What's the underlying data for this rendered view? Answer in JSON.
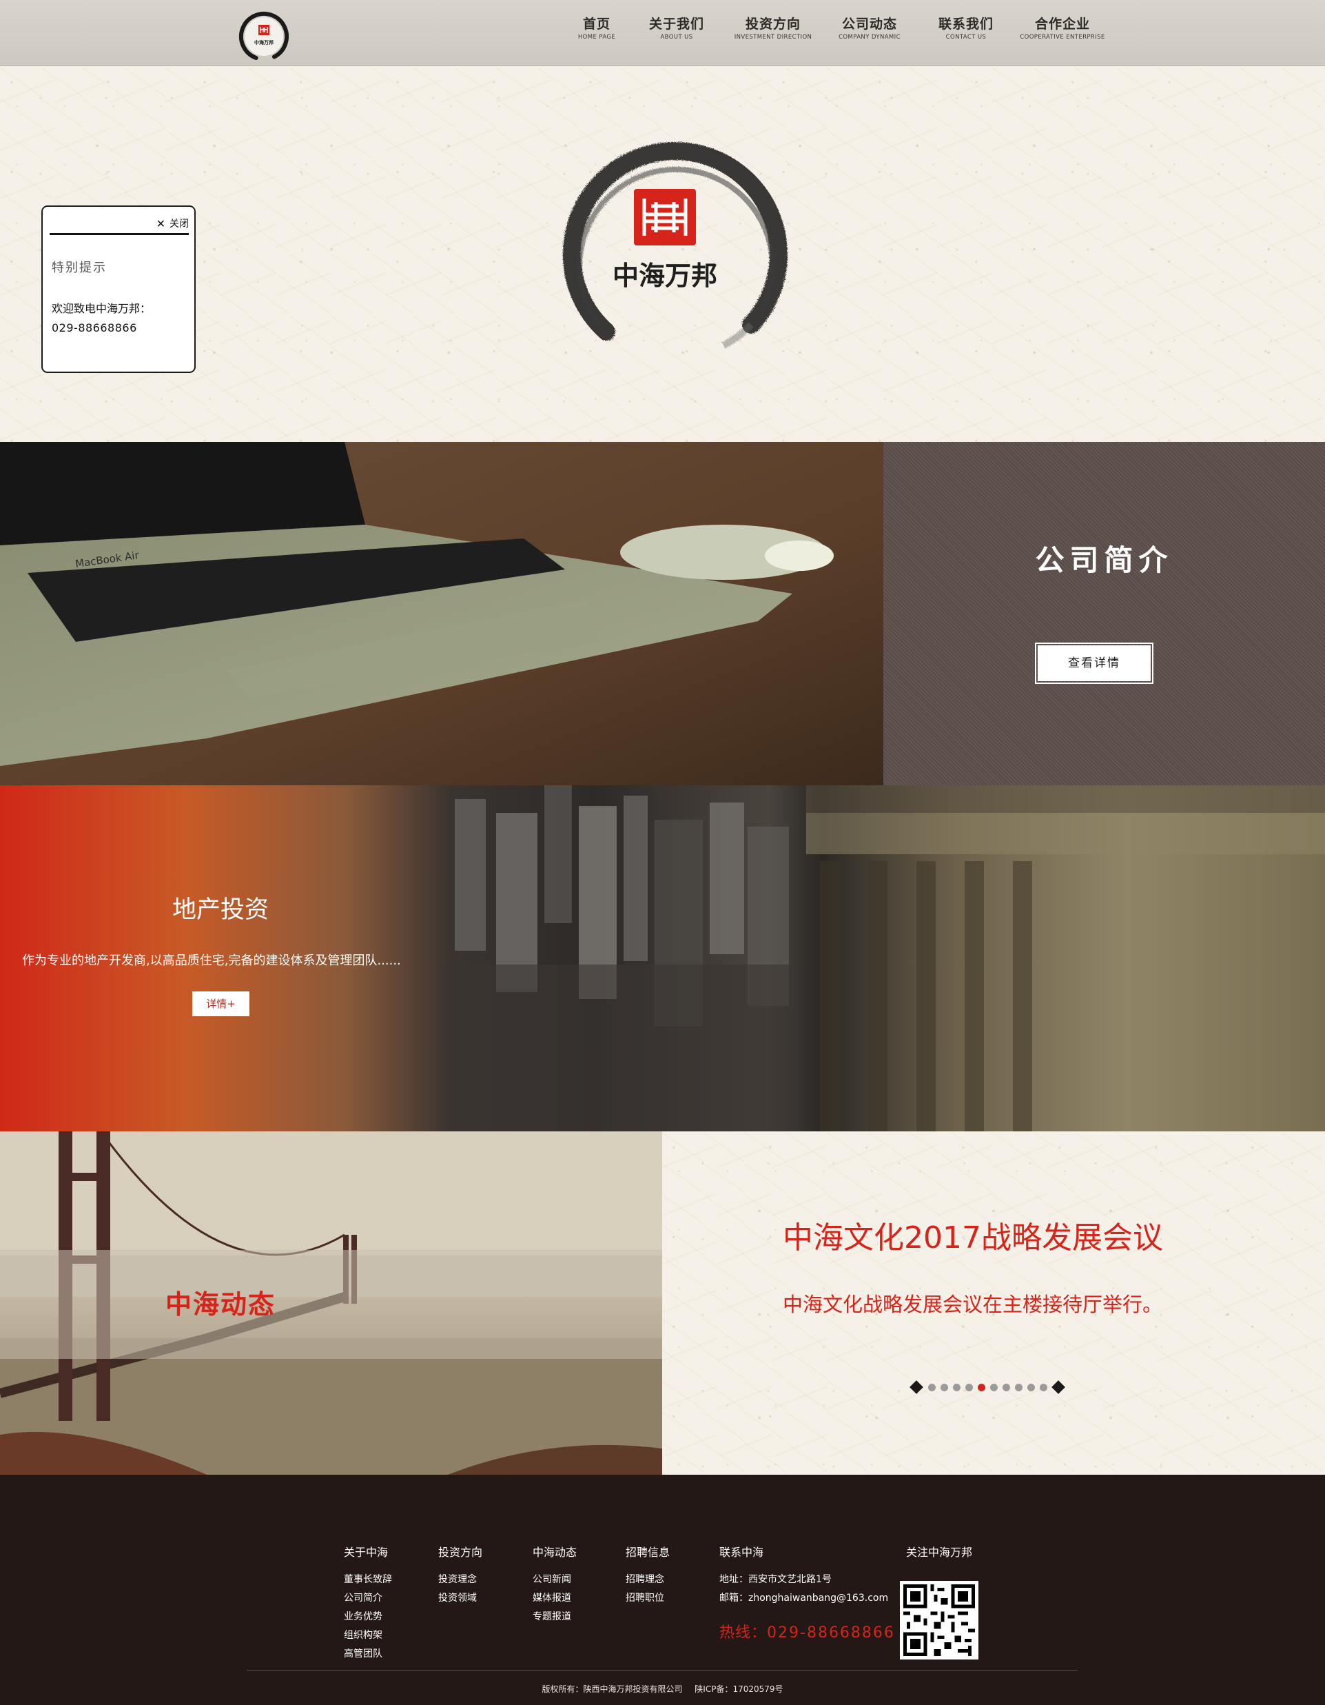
{
  "header": {
    "logo_text": "中海万邦",
    "nav": [
      {
        "zh": "首页",
        "en": "HOME PAGE"
      },
      {
        "zh": "关于我们",
        "en": "ABOUT US"
      },
      {
        "zh": "投资方向",
        "en": "INVESTMENT DIRECTION"
      },
      {
        "zh": "公司动态",
        "en": "COMPANY DYNAMIC"
      },
      {
        "zh": "联系我们",
        "en": "CONTACT US"
      },
      {
        "zh": "合作企业",
        "en": "COOPERATIVE ENTERPRISE"
      }
    ]
  },
  "hero": {
    "brand_name": "中海万邦"
  },
  "popup": {
    "close_label": "关闭",
    "title": "特别提示",
    "line1": "欢迎致电中海万邦：",
    "line2": "029-88668866"
  },
  "about": {
    "photo_caption": "MacBook Air",
    "title": "公司简介",
    "button": "查看详情"
  },
  "realestate": {
    "title": "地产投资",
    "description": "作为专业的地产开发商,以高品质住宅,完备的建设体系及管理团队......",
    "button": "详情+"
  },
  "news": {
    "label": "中海动态",
    "title": "中海文化2017战略发展会议",
    "description": "中海文化战略发展会议在主楼接待厅举行。",
    "dot_count": 10,
    "active_dot": 4
  },
  "footer": {
    "columns": [
      {
        "head": "关于中海",
        "links": [
          "董事长致辞",
          "公司简介",
          "业务优势",
          "组织构架",
          "高管团队"
        ]
      },
      {
        "head": "投资方向",
        "links": [
          "投资理念",
          "投资领域"
        ]
      },
      {
        "head": "中海动态",
        "links": [
          "公司新闻",
          "媒体报道",
          "专题报道"
        ]
      },
      {
        "head": "招聘信息",
        "links": [
          "招聘理念",
          "招聘职位"
        ]
      }
    ],
    "contact": {
      "head": "联系中海",
      "address": "地址：西安市文艺北路1号",
      "email": "邮箱：zhonghaiwanbang@163.com",
      "hotline_label": "热线：",
      "hotline": "029-88668866"
    },
    "follow_head": "关注中海万邦",
    "copyright": "版权所有：陕西中海万邦投资有限公司",
    "icp": "陕ICP备：17020579号"
  },
  "colors": {
    "brand_red": "#d7241a",
    "footer_bg": "#231815",
    "header_bg": "#d3cec6"
  }
}
